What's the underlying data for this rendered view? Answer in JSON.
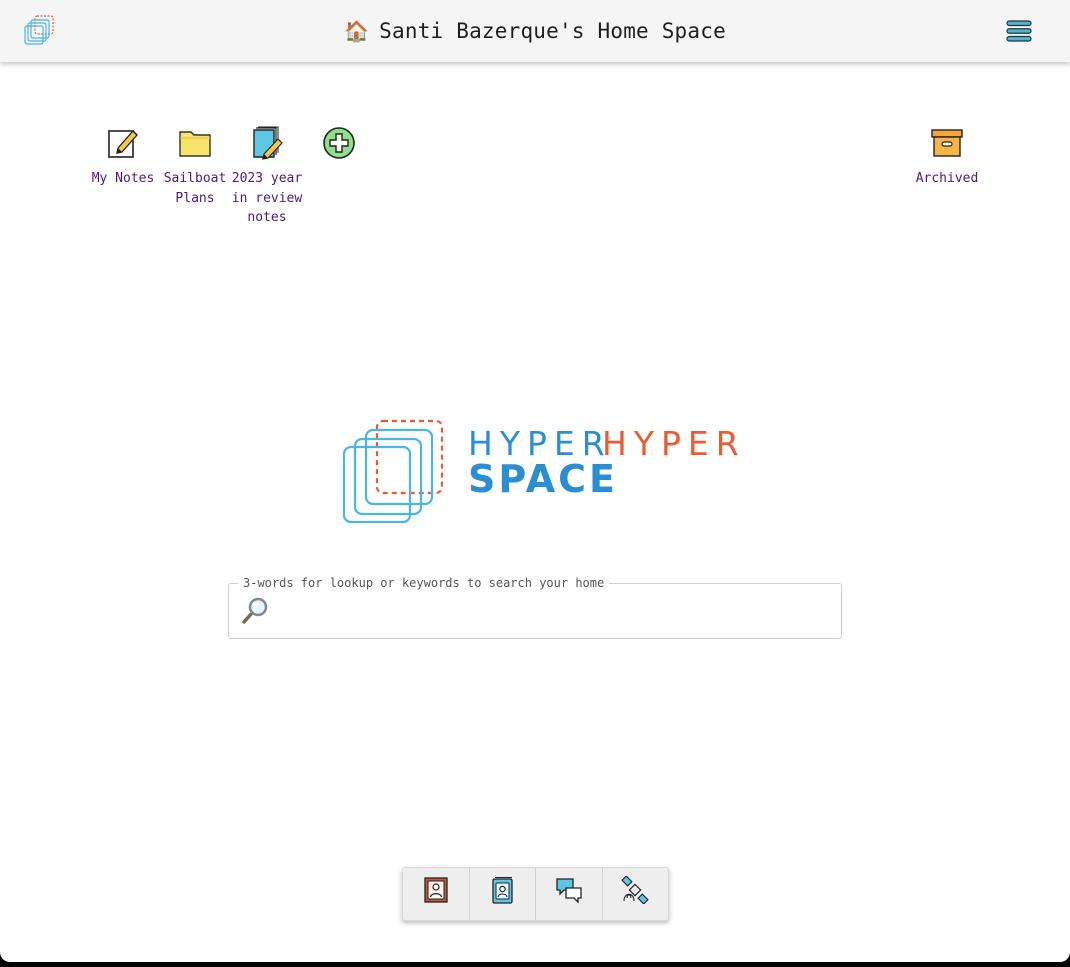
{
  "header": {
    "house_emoji": "🏠",
    "title": "Santi Bazerque's Home Space"
  },
  "folders": [
    {
      "label": "My Notes",
      "icon": "note-pencil-icon"
    },
    {
      "label": "Sailboat Plans",
      "icon": "folder-icon"
    },
    {
      "label": "2023 year in review notes",
      "icon": "notebook-pencil-icon"
    }
  ],
  "add_item": {
    "icon": "add-circle-icon"
  },
  "archived": {
    "label": "Archived",
    "icon": "archive-box-icon"
  },
  "logo": {
    "word1": "HYPER",
    "word2": "HYPER",
    "word3": "SPACE"
  },
  "search": {
    "legend": "3-words for lookup or keywords to search your home",
    "value": "",
    "placeholder": ""
  },
  "dock": [
    {
      "icon": "profile-picture-icon"
    },
    {
      "icon": "contacts-book-icon"
    },
    {
      "icon": "chat-bubbles-icon"
    },
    {
      "icon": "satellite-icon"
    }
  ],
  "colors": {
    "accent_blue": "#2a8ed6",
    "accent_orange": "#ee5a2f",
    "label_purple": "#4b1a7a",
    "header_bg": "#f5f5f5"
  }
}
